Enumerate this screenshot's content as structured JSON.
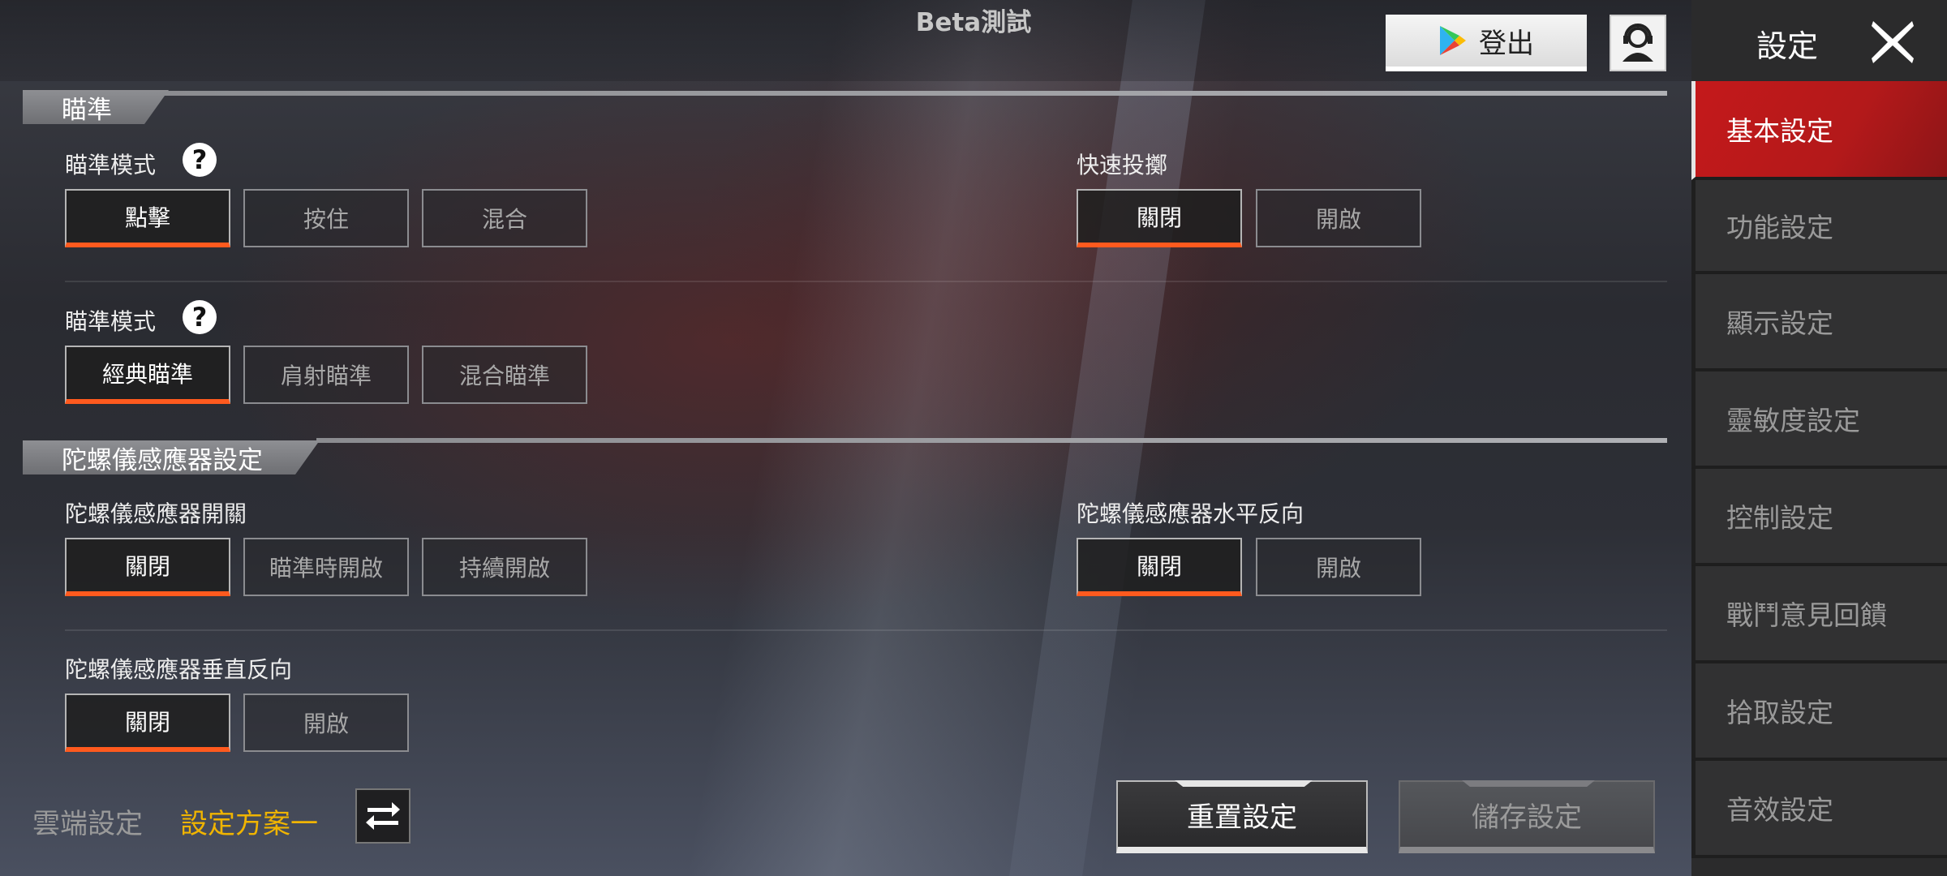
{
  "header": {
    "title": "Beta測試",
    "logout_label": "登出",
    "play_icon": "google-play-icon",
    "support_icon": "customer-support-icon"
  },
  "sidebar": {
    "title": "設定",
    "close_icon": "close-icon",
    "items": [
      {
        "label": "基本設定",
        "active": true
      },
      {
        "label": "功能設定",
        "active": false
      },
      {
        "label": "顯示設定",
        "active": false
      },
      {
        "label": "靈敏度設定",
        "active": false
      },
      {
        "label": "控制設定",
        "active": false
      },
      {
        "label": "戰鬥意見回饋",
        "active": false
      },
      {
        "label": "拾取設定",
        "active": false
      },
      {
        "label": "音效設定",
        "active": false
      }
    ]
  },
  "aim_section": {
    "title": "瞄準",
    "aim_mode_1": {
      "label": "瞄準模式",
      "options": [
        "點擊",
        "按住",
        "混合"
      ],
      "selected": "點擊"
    },
    "quick_throw": {
      "label": "快速投擲",
      "options": [
        "關閉",
        "開啟"
      ],
      "selected": "關閉"
    },
    "aim_mode_2": {
      "label": "瞄準模式",
      "options": [
        "經典瞄準",
        "肩射瞄準",
        "混合瞄準"
      ],
      "selected": "經典瞄準"
    }
  },
  "gyro_section": {
    "title": "陀螺儀感應器設定",
    "gyro_switch": {
      "label": "陀螺儀感應器開關",
      "options": [
        "關閉",
        "瞄準時開啟",
        "持續開啟"
      ],
      "selected": "關閉"
    },
    "gyro_horizontal_invert": {
      "label": "陀螺儀感應器水平反向",
      "options": [
        "關閉",
        "開啟"
      ],
      "selected": "關閉"
    },
    "gyro_vertical_invert": {
      "label": "陀螺儀感應器垂直反向",
      "options": [
        "關閉",
        "開啟"
      ],
      "selected": "關閉"
    }
  },
  "footer": {
    "cloud_label": "雲端設定",
    "plan_label": "設定方案一",
    "swap_icon": "swap-arrows-icon",
    "reset_label": "重置設定",
    "save_label": "儲存設定"
  },
  "colors": {
    "accent": "#ff5a1e",
    "active_nav": "#c4191b",
    "plan_text": "#f0b400"
  }
}
